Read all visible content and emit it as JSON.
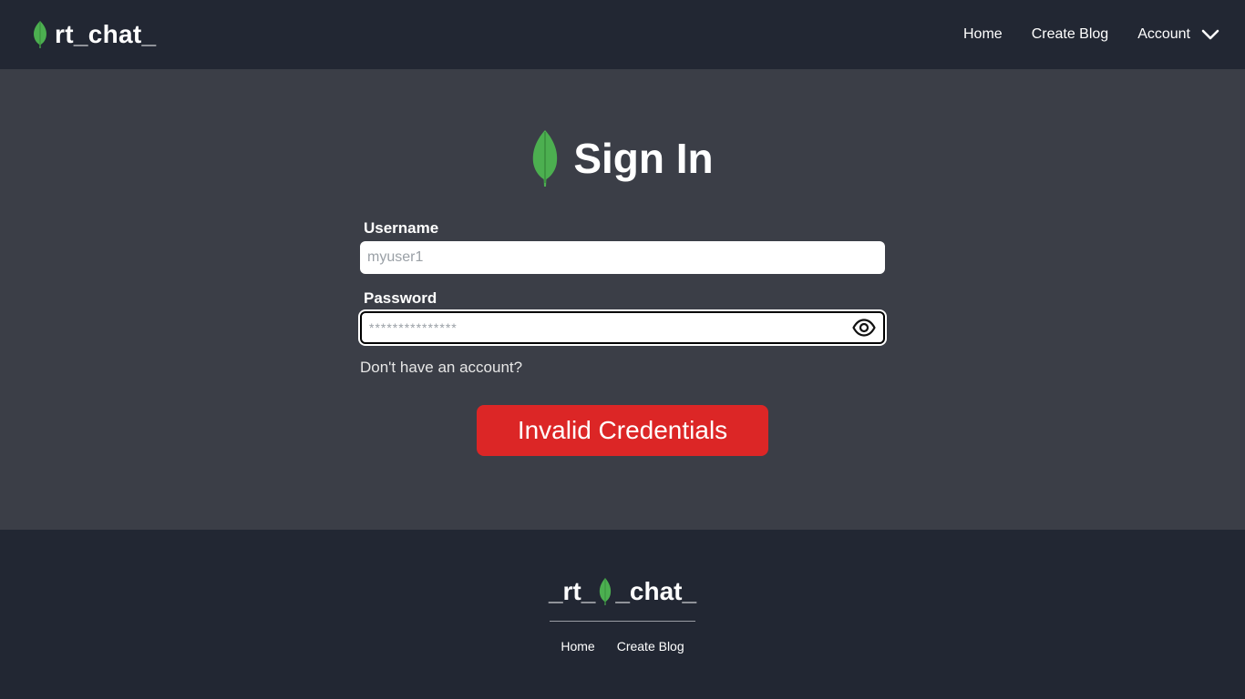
{
  "header": {
    "brand": "rt_chat_",
    "nav": [
      {
        "label": "Home"
      },
      {
        "label": "Create Blog"
      },
      {
        "label": "Account"
      }
    ]
  },
  "main": {
    "title": "Sign In",
    "username": {
      "label": "Username",
      "placeholder": "myuser1",
      "value": ""
    },
    "password": {
      "label": "Password",
      "placeholder": "***************",
      "value": ""
    },
    "signup_link": "Don't have an account?",
    "submit_label": "Invalid Credentials"
  },
  "footer": {
    "brand_left": "_rt_",
    "brand_right": "_chat_",
    "links": [
      {
        "label": "Home"
      },
      {
        "label": "Create Blog"
      }
    ]
  },
  "icons": {
    "brand": "leaf-icon",
    "account_toggle": "chevron-down-icon",
    "password_toggle": "eye-icon"
  },
  "colors": {
    "header_bg": "#222733",
    "page_bg": "#3b3e47",
    "leaf_green": "#4caf50",
    "error_button": "#dc2626"
  }
}
